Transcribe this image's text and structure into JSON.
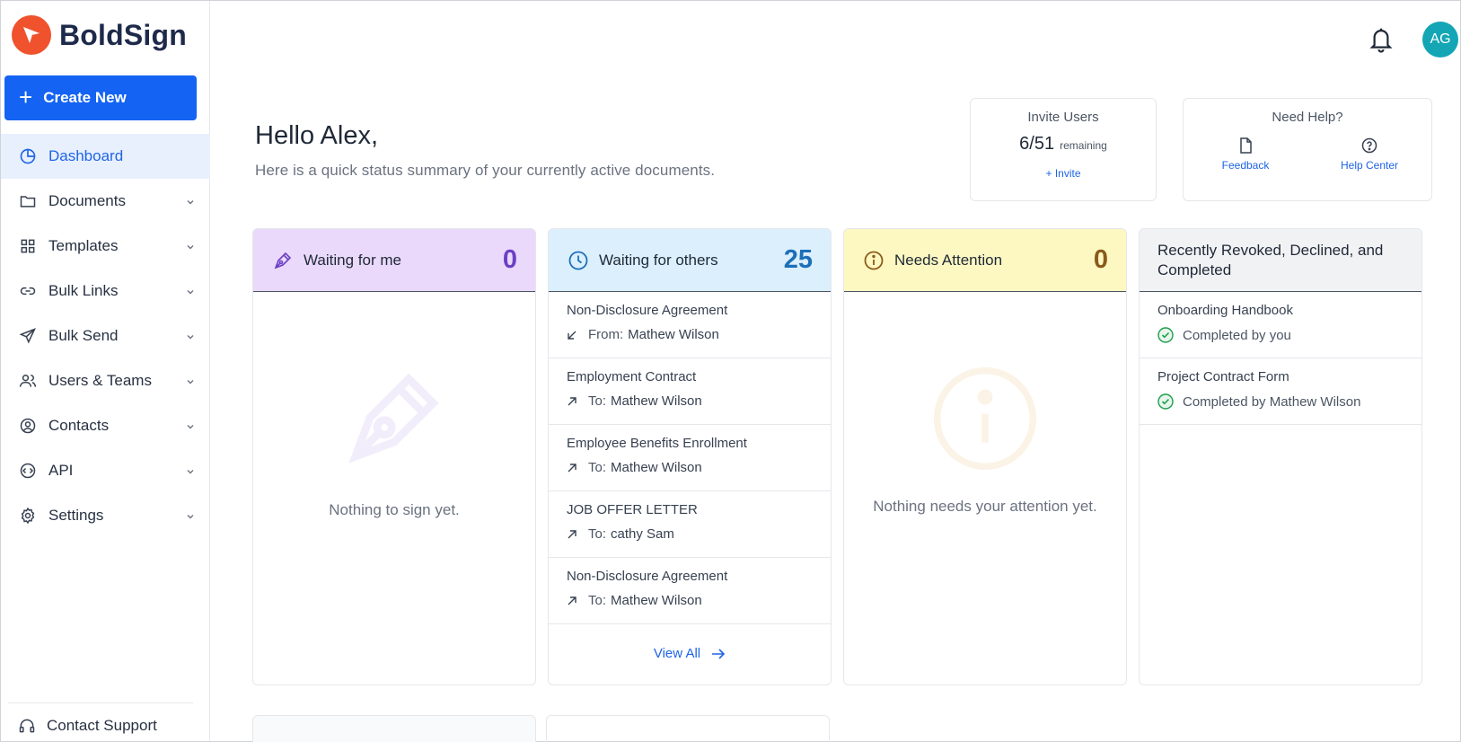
{
  "brand": {
    "name": "BoldSign",
    "color": "#f0522d"
  },
  "sidebar": {
    "create_label": "Create New",
    "items": [
      {
        "label": "Dashboard",
        "icon": "pie-chart-icon",
        "active": true
      },
      {
        "label": "Documents",
        "icon": "folder-icon"
      },
      {
        "label": "Templates",
        "icon": "grid-icon"
      },
      {
        "label": "Bulk Links",
        "icon": "link-icon"
      },
      {
        "label": "Bulk Send",
        "icon": "send-icon"
      },
      {
        "label": "Users & Teams",
        "icon": "users-icon"
      },
      {
        "label": "Contacts",
        "icon": "contact-icon"
      },
      {
        "label": "API",
        "icon": "code-icon"
      },
      {
        "label": "Settings",
        "icon": "gear-icon"
      }
    ],
    "support_label": "Contact Support"
  },
  "header": {
    "avatar_initials": "AG",
    "accent": "#1463f3"
  },
  "greeting": {
    "title": "Hello Alex,",
    "subtitle": "Here is a quick status summary of your currently active documents."
  },
  "invite": {
    "title": "Invite Users",
    "count": "6/51",
    "remaining": "remaining",
    "link": "+ Invite"
  },
  "help": {
    "title": "Need Help?",
    "feedback": "Feedback",
    "help_center": "Help Center"
  },
  "cards": {
    "waiting_me": {
      "title": "Waiting for me",
      "count": "0",
      "empty": "Nothing to sign yet.",
      "color": "#ead9fb"
    },
    "waiting_others": {
      "title": "Waiting for others",
      "count": "25",
      "color": "#dbeffd",
      "items": [
        {
          "title": "Non-Disclosure Agreement",
          "prefix": "From:",
          "person": "Mathew Wilson"
        },
        {
          "title": "Employment Contract",
          "prefix": "To:",
          "person": "Mathew Wilson"
        },
        {
          "title": "Employee Benefits Enrollment",
          "prefix": "To:",
          "person": "Mathew Wilson"
        },
        {
          "title": "JOB OFFER LETTER",
          "prefix": "To:",
          "person": "cathy Sam"
        },
        {
          "title": "Non-Disclosure Agreement",
          "prefix": "To:",
          "person": "Mathew Wilson"
        }
      ],
      "view_all": "View All"
    },
    "attention": {
      "title": "Needs Attention",
      "count": "0",
      "empty": "Nothing needs your attention yet.",
      "color": "#fdf8c2"
    },
    "recent": {
      "title": "Recently Revoked, Declined, and Completed",
      "color": "#f1f2f4",
      "items": [
        {
          "title": "Onboarding Handbook",
          "status": "Completed by you"
        },
        {
          "title": "Project Contract Form",
          "status": "Completed by Mathew Wilson"
        }
      ]
    }
  }
}
